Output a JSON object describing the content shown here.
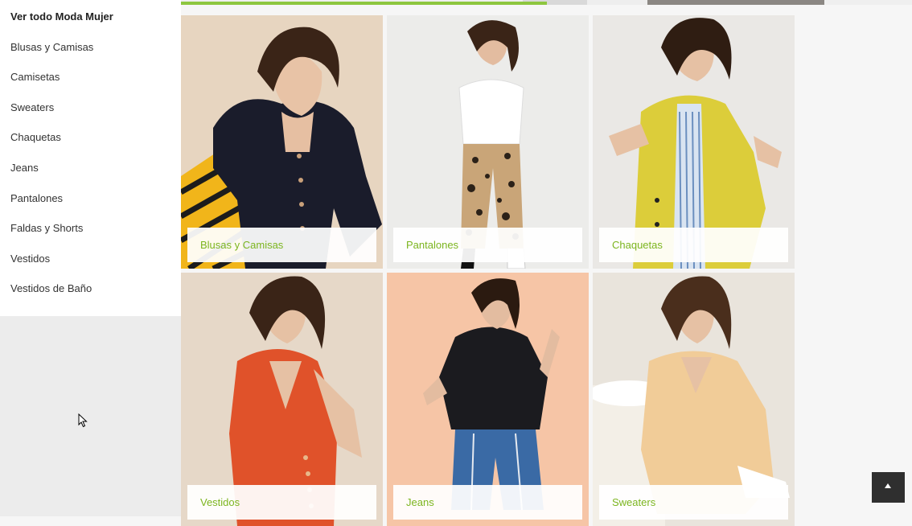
{
  "sidebar": {
    "items": [
      {
        "label": "Ver todo Moda Mujer"
      },
      {
        "label": "Blusas y Camisas"
      },
      {
        "label": "Camisetas"
      },
      {
        "label": "Sweaters"
      },
      {
        "label": "Chaquetas"
      },
      {
        "label": "Jeans"
      },
      {
        "label": "Pantalones"
      },
      {
        "label": "Faldas y Shorts"
      },
      {
        "label": "Vestidos"
      },
      {
        "label": "Vestidos de Baño"
      }
    ]
  },
  "carousel": {
    "progress_fraction": 0.5
  },
  "categories": [
    {
      "label": "Blusas y Camisas"
    },
    {
      "label": "Pantalones"
    },
    {
      "label": "Chaquetas"
    },
    {
      "label": "Vestidos"
    },
    {
      "label": "Jeans"
    },
    {
      "label": "Sweaters"
    }
  ],
  "colors": {
    "accent": "#8dc63f",
    "label_text": "#7cb51f"
  },
  "icons": {
    "scroll_top": "chevron-up-icon",
    "cursor": "mouse-cursor-icon"
  }
}
